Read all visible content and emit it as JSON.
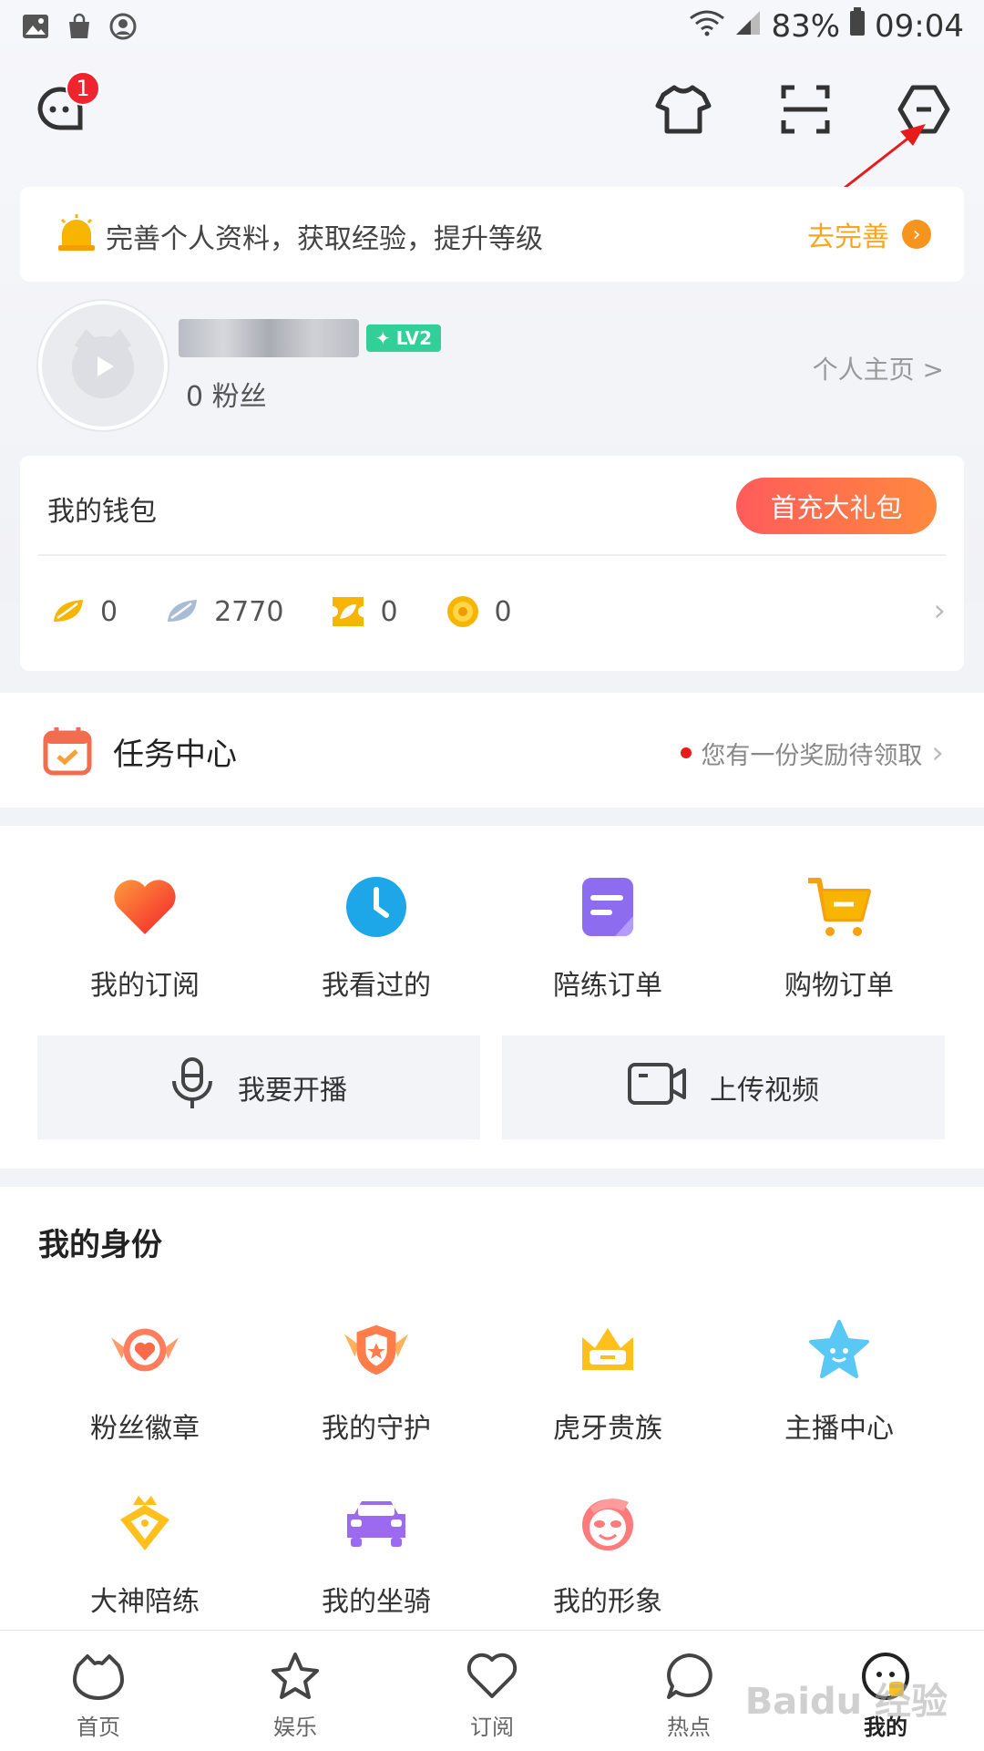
{
  "status_bar": {
    "battery": "83%",
    "time": "09:04",
    "icons": [
      "image-icon",
      "shopping-bag-icon",
      "account-icon",
      "wifi-icon",
      "signal-icon",
      "battery-icon"
    ]
  },
  "header": {
    "message_badge": "1",
    "icons": [
      "message-icon",
      "outfit-icon",
      "scan-icon",
      "settings-icon"
    ]
  },
  "banner": {
    "text": "完善个人资料，获取经验，提升等级",
    "action": "去完善"
  },
  "profile": {
    "level": "LV2",
    "fans": "0 粉丝",
    "homepage_link": "个人主页 >"
  },
  "wallet": {
    "title": "我的钱包",
    "gift_button": "首充大礼包",
    "items": [
      {
        "icon": "gold-bean-icon",
        "value": "0"
      },
      {
        "icon": "silver-bean-icon",
        "value": "2770"
      },
      {
        "icon": "ticket-icon",
        "value": "0"
      },
      {
        "icon": "coin-icon",
        "value": "0"
      }
    ]
  },
  "task_center": {
    "title": "任务中心",
    "hint": "您有一份奖励待领取"
  },
  "quick_links": [
    {
      "label": "我的订阅",
      "icon": "heart-icon"
    },
    {
      "label": "我看过的",
      "icon": "clock-icon"
    },
    {
      "label": "陪练订单",
      "icon": "order-icon"
    },
    {
      "label": "购物订单",
      "icon": "cart-icon"
    }
  ],
  "actions": {
    "go_live": "我要开播",
    "upload_video": "上传视频"
  },
  "identity": {
    "title": "我的身份",
    "items": [
      {
        "label": "粉丝徽章",
        "icon": "fan-badge-icon"
      },
      {
        "label": "我的守护",
        "icon": "guard-icon"
      },
      {
        "label": "虎牙贵族",
        "icon": "crown-icon"
      },
      {
        "label": "主播中心",
        "icon": "star-icon"
      },
      {
        "label": "大神陪练",
        "icon": "master-icon"
      },
      {
        "label": "我的坐骑",
        "icon": "car-icon"
      },
      {
        "label": "我的形象",
        "icon": "face-icon"
      }
    ]
  },
  "bottom_nav": [
    {
      "label": "首页",
      "icon": "home-icon"
    },
    {
      "label": "娱乐",
      "icon": "entertainment-icon"
    },
    {
      "label": "订阅",
      "icon": "subscribe-icon"
    },
    {
      "label": "热点",
      "icon": "hot-icon"
    },
    {
      "label": "我的",
      "icon": "me-icon"
    }
  ],
  "watermark": "Baidu 经验",
  "colors": {
    "accent_orange": "#f7941d",
    "level_green": "#33cf98",
    "gift_gradient_start": "#ff5b5b",
    "gift_gradient_end": "#ff8a3d"
  }
}
